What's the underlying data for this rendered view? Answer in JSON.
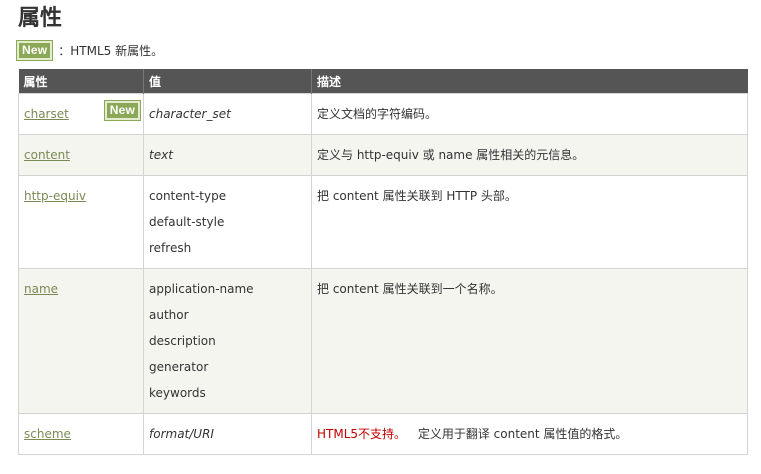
{
  "heading": "属性",
  "legend": {
    "badge": "New",
    "text": "：HTML5 新属性。"
  },
  "table": {
    "headers": [
      "属性",
      "值",
      "描述"
    ],
    "rows": [
      {
        "attribute": "charset",
        "badge": "New",
        "values": [
          "character_set"
        ],
        "italic": true,
        "note": "",
        "description": "定义文档的字符编码。"
      },
      {
        "attribute": "content",
        "values": [
          "text"
        ],
        "italic": true,
        "note": "",
        "description": "定义与 http-equiv 或 name 属性相关的元信息。"
      },
      {
        "attribute": "http-equiv",
        "values": [
          "content-type",
          "default-style",
          "refresh"
        ],
        "italic": false,
        "note": "",
        "description": "把 content 属性关联到 HTTP 头部。"
      },
      {
        "attribute": "name",
        "values": [
          "application-name",
          "author",
          "description",
          "generator",
          "keywords"
        ],
        "italic": false,
        "note": "",
        "description": "把 content 属性关联到一个名称。"
      },
      {
        "attribute": "scheme",
        "values": [
          "format/URI"
        ],
        "italic": true,
        "note": "HTML5不支持。",
        "description": "定义用于翻译 content 属性值的格式。"
      }
    ]
  }
}
